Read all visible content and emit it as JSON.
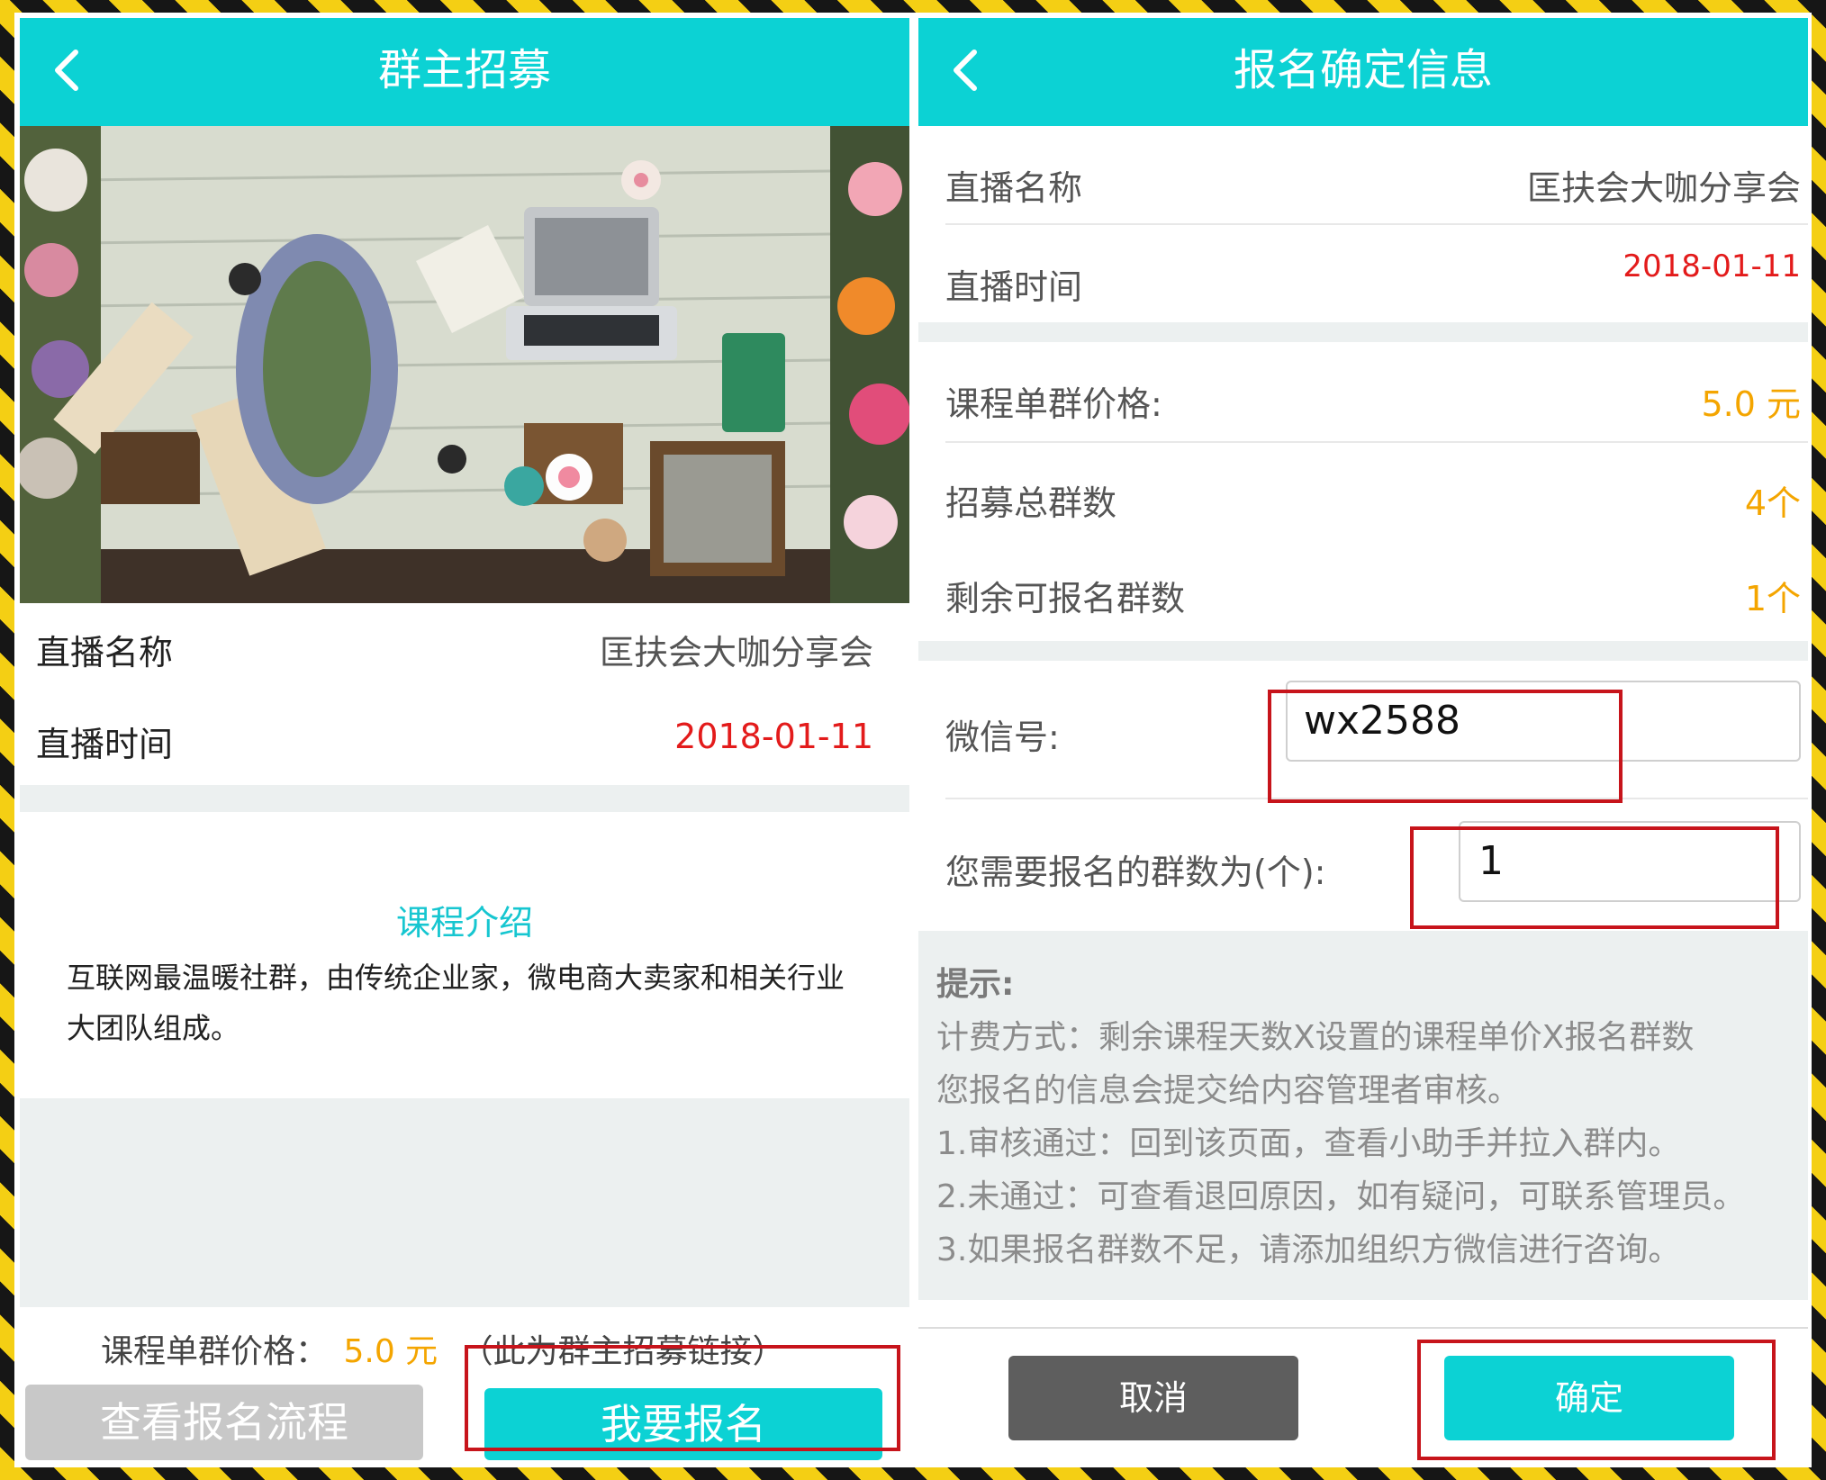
{
  "left": {
    "title": "群主招募",
    "live_name_label": "直播名称",
    "live_name_value": "匡扶会大咖分享会",
    "live_time_label": "直播时间",
    "live_time_value": "2018-01-11",
    "course_intro_title": "课程介绍",
    "course_intro_text": "互联网最温暖社群，由传统企业家，微电商大卖家和相关行业大团队组成。",
    "price_label": "课程单群价格：",
    "price_value": "5.0 元",
    "price_note": "（此为群主招募链接）",
    "view_process_button": "查看报名流程",
    "signup_button": "我要报名"
  },
  "right": {
    "title": "报名确定信息",
    "live_name_label": "直播名称",
    "live_name_value": "匡扶会大咖分享会",
    "live_time_label": "直播时间",
    "live_time_value": "2018-01-11",
    "price_label": "课程单群价格:",
    "price_value": "5.0 元",
    "total_groups_label": "招募总群数",
    "total_groups_value": "4个",
    "remaining_label": "剩余可报名群数",
    "remaining_value": "1个",
    "wechat_label": "微信号:",
    "wechat_value": "wx2588",
    "groups_needed_label": "您需要报名的群数为(个):",
    "groups_needed_value": "1",
    "tips_title": "提示:",
    "tips_lines": [
      "计费方式：剩余课程天数X设置的课程单价X报名群数",
      "您报名的信息会提交给内容管理者审核。",
      "1.审核通过：回到该页面，查看小助手并拉入群内。",
      "2.未通过：可查看退回原因，如有疑问，可联系管理员。",
      "3.如果报名群数不足，请添加组织方微信进行咨询。"
    ],
    "cancel_button": "取消",
    "confirm_button": "确定"
  },
  "colors": {
    "nav": "#0cd2d4",
    "accent_text": "#16c6d0",
    "date_red": "#e31b1b",
    "price_orange": "#f4a500",
    "highlight_box": "#c7141b",
    "cancel_gray": "#5e5e5e",
    "disabled_gray": "#c8c8c8"
  },
  "icons": {
    "back": "chevron-left-icon"
  }
}
